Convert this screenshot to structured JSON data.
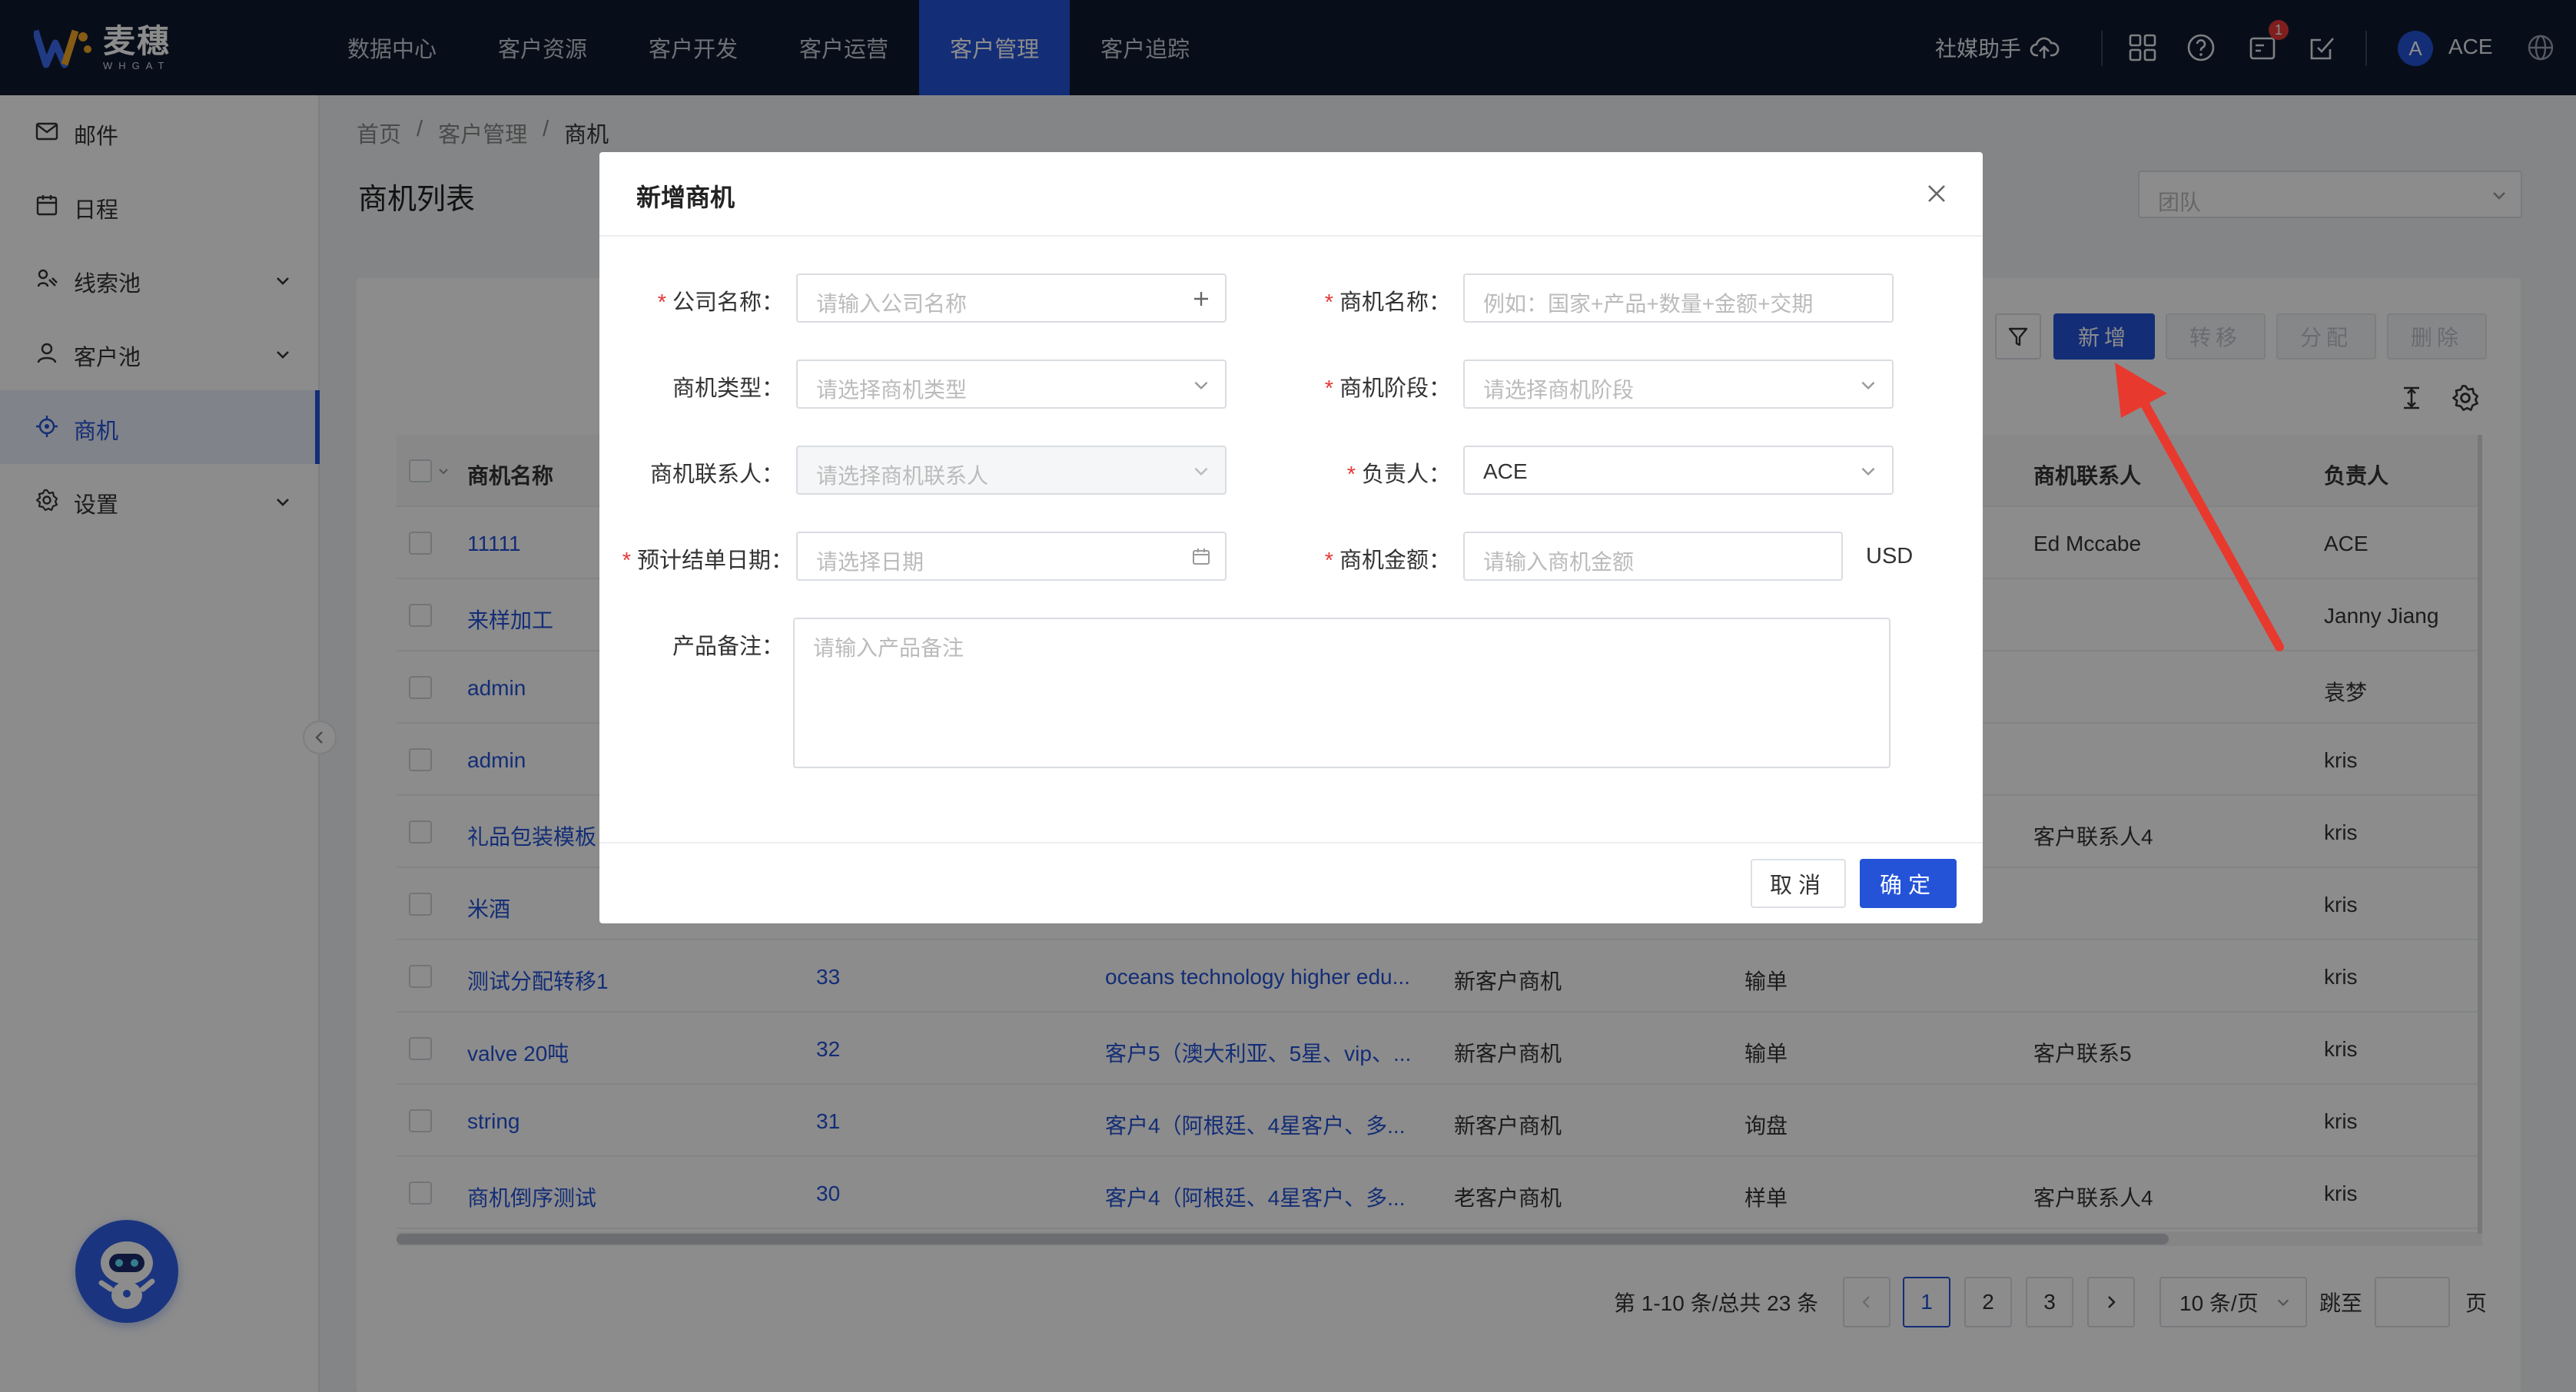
{
  "brand": {
    "name": "麦穗",
    "subname": "WHGAT"
  },
  "nav": {
    "items": [
      "数据中心",
      "客户资源",
      "客户开发",
      "客户运营",
      "客户管理",
      "客户追踪"
    ],
    "active": 4
  },
  "topbar_right": {
    "assistant_label": "社媒助手",
    "notification_count": "1",
    "avatar_initial": "A",
    "user_name": "ACE"
  },
  "sidebar": {
    "items": [
      {
        "label": "邮件",
        "icon": "mail-icon",
        "expandable": false
      },
      {
        "label": "日程",
        "icon": "calendar-icon",
        "expandable": false
      },
      {
        "label": "线索池",
        "icon": "leads-icon",
        "expandable": true
      },
      {
        "label": "客户池",
        "icon": "user-icon",
        "expandable": true
      },
      {
        "label": "商机",
        "icon": "target-icon",
        "expandable": false,
        "active": true
      },
      {
        "label": "设置",
        "icon": "gear-icon",
        "expandable": true
      }
    ]
  },
  "breadcrumb": {
    "items": [
      "首页",
      "客户管理",
      "商机"
    ],
    "separator": "/"
  },
  "page": {
    "title": "商机列表",
    "team_placeholder": "团队"
  },
  "toolbar": {
    "add_label": "新增",
    "transfer_label": "转移",
    "assign_label": "分配",
    "delete_label": "删除"
  },
  "table": {
    "columns": [
      "商机名称",
      "商机联系人",
      "负责人"
    ],
    "rows": [
      {
        "name": "11111",
        "id": "",
        "company": "",
        "type": "",
        "stage": "",
        "contact": "Ed Mccabe",
        "owner": "ACE"
      },
      {
        "name": "来样加工",
        "id": "",
        "company": "",
        "type": "",
        "stage": "",
        "contact": "",
        "owner": "Janny Jiang"
      },
      {
        "name": "admin",
        "id": "",
        "company": "",
        "type": "",
        "stage": "",
        "contact": "",
        "owner": "袁梦"
      },
      {
        "name": "admin",
        "id": "",
        "company": "",
        "type": "",
        "stage": "",
        "contact": "",
        "owner": "kris"
      },
      {
        "name": "礼品包装模板",
        "id": "",
        "company": "",
        "type": "",
        "stage": "",
        "contact": "客户联系人4",
        "owner": "kris"
      },
      {
        "name": "米酒",
        "id": "",
        "company": "",
        "type": "",
        "stage": "",
        "contact": "",
        "owner": "kris"
      },
      {
        "name": "测试分配转移1",
        "id": "33",
        "company": "oceans technology higher edu...",
        "type": "新客户商机",
        "stage": "输单",
        "contact": "",
        "owner": "kris"
      },
      {
        "name": "valve 20吨",
        "id": "32",
        "company": "客户5（澳大利亚、5星、vip、...",
        "type": "新客户商机",
        "stage": "输单",
        "contact": "客户联系5",
        "owner": "kris"
      },
      {
        "name": "string",
        "id": "31",
        "company": "客户4（阿根廷、4星客户、多...",
        "type": "新客户商机",
        "stage": "询盘",
        "contact": "",
        "owner": "kris"
      },
      {
        "name": "商机倒序测试",
        "id": "30",
        "company": "客户4（阿根廷、4星客户、多...",
        "type": "老客户商机",
        "stage": "样单",
        "contact": "客户联系人4",
        "owner": "kris"
      }
    ]
  },
  "pagination": {
    "summary": "第 1-10 条/总共 23 条",
    "pages": [
      "1",
      "2",
      "3"
    ],
    "current": "1",
    "page_size": "10 条/页",
    "jump_label": "跳至",
    "page_suffix": "页"
  },
  "modal": {
    "title": "新增商机",
    "company_label": "公司名称：",
    "company_placeholder": "请输入公司名称",
    "opp_name_label": "商机名称：",
    "opp_name_placeholder": "例如：国家+产品+数量+金额+交期",
    "type_label": "商机类型：",
    "type_placeholder": "请选择商机类型",
    "stage_label": "商机阶段：",
    "stage_placeholder": "请选择商机阶段",
    "contact_label": "商机联系人：",
    "contact_placeholder": "请选择商机联系人",
    "owner_label": "负责人：",
    "owner_value": "ACE",
    "close_date_label": "预计结单日期：",
    "close_date_placeholder": "请选择日期",
    "amount_label": "商机金额：",
    "amount_placeholder": "请输入商机金额",
    "currency": "USD",
    "notes_label": "产品备注：",
    "notes_placeholder": "请输入产品备注",
    "cancel_label": "取消",
    "ok_label": "确定"
  },
  "colors": {
    "primary": "#2453d8",
    "topbar": "#0f1b2f",
    "required": "#e53935",
    "arrow": "#e8392f"
  }
}
